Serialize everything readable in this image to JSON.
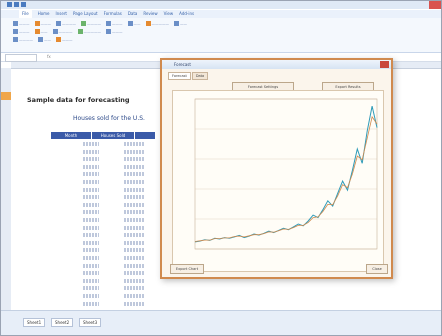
{
  "ribbon_tabs": [
    "File",
    "Home",
    "Insert",
    "Page Layout",
    "Formulas",
    "Data",
    "Review",
    "View",
    "Add-ins"
  ],
  "name_box": "",
  "sheet": {
    "title": "Sample data for forecasting",
    "subtitle": "Houses sold for the U.S.",
    "headers": [
      "Month",
      "Houses Sold"
    ],
    "selected_row": "4"
  },
  "sheet_tabs": [
    "Sheet1",
    "Sheet2",
    "Sheet3"
  ],
  "dialog": {
    "title": "Forecast",
    "tabs": [
      "Forecast",
      "Data"
    ],
    "top_buttons": [
      "Forecast Settings",
      "Export Results"
    ],
    "bottom_left_button": "Export Chart",
    "bottom_right_button": "Close"
  },
  "chart_data": {
    "type": "line",
    "series": [
      {
        "values": [
          2,
          2.2,
          2.6,
          2.4,
          3.0,
          2.8,
          3.2,
          3.0,
          3.4,
          3.8,
          3.2,
          3.6,
          4.2,
          3.9,
          4.4,
          5.0,
          4.6,
          5.2,
          5.8,
          5.4,
          6.2,
          7.0,
          6.5,
          7.8,
          9.5,
          8.8,
          11.0,
          13.5,
          12.0,
          15.5,
          19.0,
          16.5,
          22.0,
          28.0,
          24.0,
          33.0,
          40.0,
          34.0
        ]
      },
      {
        "values": [
          2.1,
          2.3,
          2.5,
          2.5,
          2.9,
          2.9,
          3.1,
          3.1,
          3.5,
          3.6,
          3.4,
          3.7,
          4.0,
          4.0,
          4.3,
          4.8,
          4.7,
          5.1,
          5.6,
          5.5,
          6.0,
          6.6,
          6.6,
          7.4,
          8.8,
          9.0,
          10.5,
          12.5,
          12.4,
          14.8,
          18.0,
          17.2,
          21.0,
          26.0,
          25.0,
          31.0,
          37.0,
          35.0
        ]
      }
    ],
    "colors": [
      "#2e9bb8",
      "#d08a4e"
    ]
  }
}
